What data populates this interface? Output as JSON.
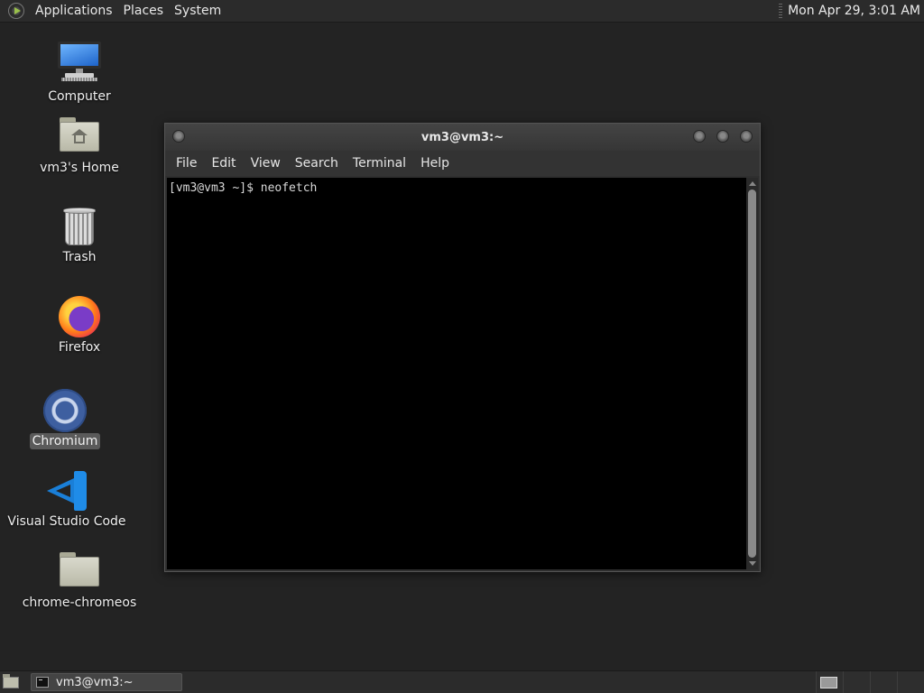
{
  "top_panel": {
    "menus": [
      "Applications",
      "Places",
      "System"
    ],
    "clock": "Mon Apr 29,  3:01 AM"
  },
  "desktop_icons": [
    {
      "label": "Computer",
      "icon": "computer-icon"
    },
    {
      "label": "vm3's Home",
      "icon": "home-folder-icon"
    },
    {
      "label": "Trash",
      "icon": "trash-icon"
    },
    {
      "label": "Firefox",
      "icon": "firefox-icon"
    },
    {
      "label": "Chromium",
      "icon": "chromium-icon",
      "selected": true
    },
    {
      "label": "Visual Studio Code",
      "icon": "vscode-icon"
    },
    {
      "label": "chrome-chromeos",
      "icon": "folder-icon"
    }
  ],
  "terminal": {
    "title": "vm3@vm3:~",
    "menu": [
      "File",
      "Edit",
      "View",
      "Search",
      "Terminal",
      "Help"
    ],
    "lines": [
      "[vm3@vm3 ~]$ neofetch"
    ]
  },
  "taskbar": {
    "items": [
      {
        "label": "vm3@vm3:~",
        "icon": "terminal-icon"
      }
    ],
    "workspace_count": 4,
    "active_workspace": 1
  }
}
